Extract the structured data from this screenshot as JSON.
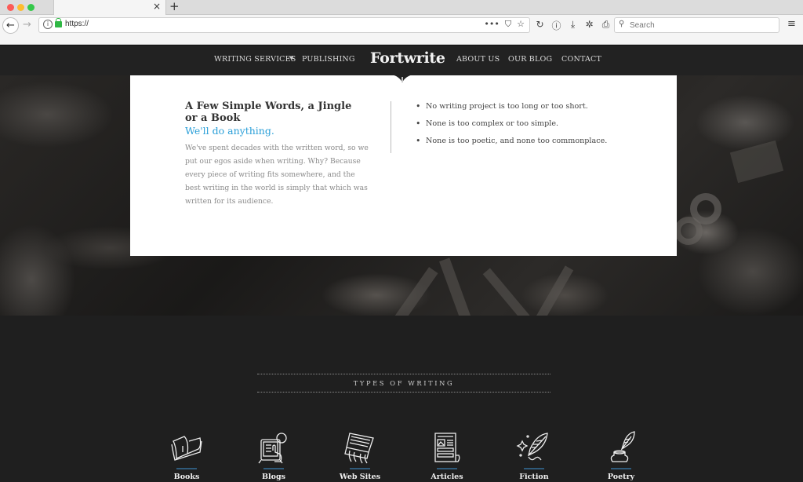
{
  "browser": {
    "tab_close": "×",
    "new_tab": "+",
    "back": "←",
    "forward": "→",
    "url": "https://",
    "url_icons": {
      "more": "•••",
      "pocket": "⛉",
      "bookmark": "☆"
    },
    "tools": {
      "reload": "↻",
      "info": "ⓘ",
      "download": "⤓",
      "extensions": "✲",
      "print": "⎙"
    },
    "search_placeholder": "Search",
    "search_icon": "⚲",
    "menu": "≡"
  },
  "site": {
    "logo": "Fortwrite",
    "nav": {
      "writing_services": "Writing Services",
      "caret": "▼",
      "publishing": "Publishing",
      "about": "About Us",
      "blog": "Our Blog",
      "contact": "Contact"
    }
  },
  "hero_card": {
    "title": "A Few Simple Words, a Jingle or a Book",
    "subtitle": "We'll do anything.",
    "body": "We've spent decades with the written word, so we put our egos aside when writing.  Why?  Because every piece of writing fits somewhere, and the best writing in the world is simply that which was written for its audience.",
    "bullets": [
      "No writing project is too long or too short.",
      "None is too complex or too simple.",
      "None is too poetic, and none too commonplace."
    ],
    "accent_color": "#2a9fd8"
  },
  "types": {
    "heading": "Types of Writing",
    "items": [
      {
        "label": "Books",
        "icon": "open-book-icon"
      },
      {
        "label": "Blogs",
        "icon": "tablet-touch-icon"
      },
      {
        "label": "Web Sites",
        "icon": "laptop-typing-icon"
      },
      {
        "label": "Articles",
        "icon": "newspaper-icon"
      },
      {
        "label": "Fiction",
        "icon": "quill-sparkle-icon"
      },
      {
        "label": "Poetry",
        "icon": "quill-inkwell-icon"
      }
    ],
    "bar_color": "#2f5a7a"
  }
}
